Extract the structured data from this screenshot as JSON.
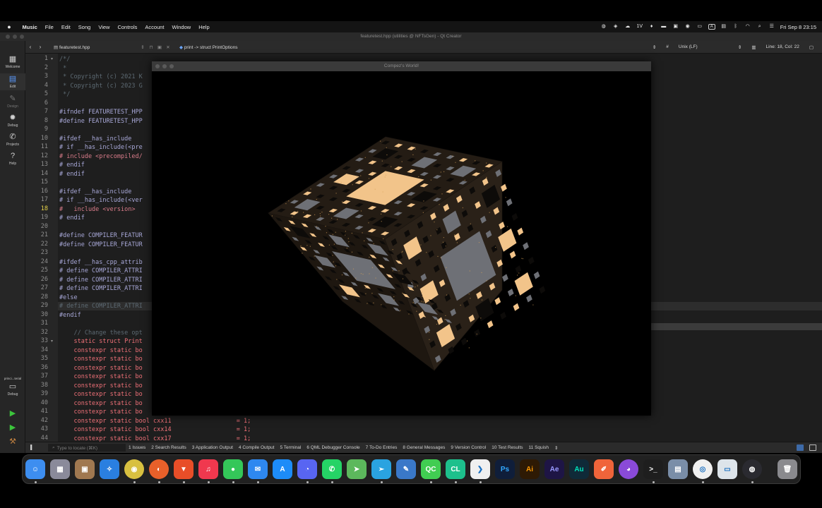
{
  "menubar": {
    "app": "Music",
    "menus": [
      "File",
      "Edit",
      "Song",
      "View",
      "Controls",
      "Account",
      "Window",
      "Help"
    ],
    "status_text": "1V",
    "input_badge": "A",
    "clock": "Fri Sep 8  23:15"
  },
  "qt": {
    "window_title": "featuretest.hpp (utilities @ NFTsGen) - Qt Creator",
    "file_name": "featuretest.hpp",
    "symbol": "print -> struct PrintOptions",
    "line_endings": "Unix (LF)",
    "position": "Line: 18, Col: 22",
    "hash_mark": "#",
    "modes": [
      {
        "icon": "grid-icon",
        "label": "Welcome"
      },
      {
        "icon": "edit-icon",
        "label": "Edit"
      },
      {
        "icon": "design-icon",
        "label": "Design"
      },
      {
        "icon": "debug-icon",
        "label": "Debug"
      },
      {
        "icon": "wrench-icon",
        "label": "Projects"
      },
      {
        "icon": "help-icon",
        "label": "Help"
      }
    ],
    "kit": {
      "name": "princi...terial",
      "config": "Debug"
    },
    "locator_placeholder": "Type to locate (⌘K)",
    "panes": [
      "1  Issues",
      "2  Search Results",
      "3  Application Output",
      "4  Compile Output",
      "5  Terminal",
      "6  QML Debugger Console",
      "7  To-Do Entries",
      "8  General Messages",
      "9  Version Control",
      "10  Test Results",
      "11  Squish"
    ],
    "current_line": 18,
    "code_lines": [
      {
        "n": "1",
        "t": "/*/",
        "c": "c-com"
      },
      {
        "n": "2",
        "t": " *",
        "c": "c-com"
      },
      {
        "n": "3",
        "t": " * Copyright (c) 2021 K",
        "c": "c-com"
      },
      {
        "n": "4",
        "t": " * Copyright (c) 2023 G",
        "c": "c-com"
      },
      {
        "n": "5",
        "t": " */",
        "c": "c-com"
      },
      {
        "n": "6",
        "t": "",
        "c": "c-tx"
      },
      {
        "n": "7",
        "t": "#ifndef FEATURETEST_HPP",
        "c": "c-pp"
      },
      {
        "n": "8",
        "t": "#define FEATURETEST_HPP",
        "c": "c-pp"
      },
      {
        "n": "9",
        "t": "",
        "c": "c-tx"
      },
      {
        "n": "10",
        "t": "#ifdef __has_include",
        "c": "c-pp"
      },
      {
        "n": "11",
        "t": "# if __has_include(<pre",
        "c": "c-pp"
      },
      {
        "n": "12",
        "t": "# include <precompiled/",
        "c": "c-inc"
      },
      {
        "n": "13",
        "t": "# endif",
        "c": "c-pp"
      },
      {
        "n": "14",
        "t": "# endif",
        "c": "c-pp"
      },
      {
        "n": "15",
        "t": "",
        "c": "c-tx"
      },
      {
        "n": "16",
        "t": "#ifdef __has_include",
        "c": "c-pp"
      },
      {
        "n": "17",
        "t": "# if __has_include(<ver",
        "c": "c-pp"
      },
      {
        "n": "18",
        "t": "#   include <version>",
        "c": "c-inc"
      },
      {
        "n": "19",
        "t": "# endif",
        "c": "c-pp"
      },
      {
        "n": "20",
        "t": "",
        "c": "c-tx"
      },
      {
        "n": "21",
        "t": "#define COMPILER_FEATUR",
        "c": "c-pp"
      },
      {
        "n": "22",
        "t": "#define COMPILER_FEATUR",
        "c": "c-pp"
      },
      {
        "n": "23",
        "t": "",
        "c": "c-tx"
      },
      {
        "n": "24",
        "t": "#ifdef __has_cpp_attrib",
        "c": "c-pp"
      },
      {
        "n": "25",
        "t": "# define COMPILER_ATTRI",
        "c": "c-pp"
      },
      {
        "n": "26",
        "t": "# define COMPILER_ATTRI",
        "c": "c-pp"
      },
      {
        "n": "27",
        "t": "# define COMPILER_ATTRI",
        "c": "c-pp"
      },
      {
        "n": "28",
        "t": "#else",
        "c": "c-pp"
      },
      {
        "n": "29",
        "t": "# define COMPILER_ATTRI",
        "c": "c-com"
      },
      {
        "n": "30",
        "t": "#endif",
        "c": "c-pp"
      },
      {
        "n": "31",
        "t": "",
        "c": "c-tx"
      },
      {
        "n": "32",
        "t": "    // Change these opt",
        "c": "c-com"
      },
      {
        "n": "33",
        "t": "    static struct Print",
        "c": "c-kw"
      },
      {
        "n": "34",
        "t": "    constexpr static bo",
        "c": "c-kw"
      },
      {
        "n": "35",
        "t": "    constexpr static bo",
        "c": "c-kw"
      },
      {
        "n": "36",
        "t": "    constexpr static bo",
        "c": "c-kw"
      },
      {
        "n": "37",
        "t": "    constexpr static bo",
        "c": "c-kw"
      },
      {
        "n": "38",
        "t": "    constexpr static bo",
        "c": "c-kw"
      },
      {
        "n": "39",
        "t": "    constexpr static bo",
        "c": "c-kw"
      },
      {
        "n": "40",
        "t": "    constexpr static bo",
        "c": "c-kw"
      },
      {
        "n": "41",
        "t": "    constexpr static bo",
        "c": "c-kw"
      },
      {
        "n": "42",
        "t": "    constexpr static bool cxx11                  = 1;",
        "c": "c-kw"
      },
      {
        "n": "43",
        "t": "    constexpr static bool cxx14                  = 1;",
        "c": "c-kw"
      },
      {
        "n": "44",
        "t": "    constexpr static bool cxx17                  = 1;",
        "c": "c-kw"
      }
    ]
  },
  "gl": {
    "title": "Compez's World!",
    "palette": {
      "edge": "#1a1510",
      "face_top": "#241c14",
      "face_left": "#1e1710",
      "face_right": "#2a2118",
      "hole_light": "#f2c48a",
      "hole_grey": "#6e7076",
      "hole_dark": "#0d0b09",
      "sparkle": "#d8a35a"
    }
  },
  "dock": {
    "apps": [
      {
        "name": "finder-icon",
        "color": "#3d8ef0",
        "glyph": "☺"
      },
      {
        "name": "launchpad-icon",
        "color": "#8a8a9a",
        "glyph": "▦"
      },
      {
        "name": "archive-icon",
        "color": "#a07850",
        "glyph": "▣"
      },
      {
        "name": "safari-icon",
        "color": "#2a7fe0",
        "glyph": "✧"
      },
      {
        "name": "chrome-icon",
        "color": "#d8c040",
        "glyph": "◉"
      },
      {
        "name": "firefox-icon",
        "color": "#e8602a",
        "glyph": "◐"
      },
      {
        "name": "brave-icon",
        "color": "#e84e28",
        "glyph": "▼"
      },
      {
        "name": "music-icon",
        "color": "#f0384e",
        "glyph": "♫"
      },
      {
        "name": "messages-icon",
        "color": "#34c759",
        "glyph": "●"
      },
      {
        "name": "mail-icon",
        "color": "#2e88f0",
        "glyph": "✉"
      },
      {
        "name": "appstore-icon",
        "color": "#1d8cf8",
        "glyph": "A"
      },
      {
        "name": "discord-icon",
        "color": "#5865f2",
        "glyph": "◔"
      },
      {
        "name": "whatsapp-icon",
        "color": "#25d366",
        "glyph": "✆"
      },
      {
        "name": "maps-icon",
        "color": "#5cb85c",
        "glyph": "➤"
      },
      {
        "name": "telegram-icon",
        "color": "#2aa3e0",
        "glyph": "➢"
      },
      {
        "name": "instruments-icon",
        "color": "#3a78c8",
        "glyph": "✎"
      },
      {
        "name": "qtcreator-icon",
        "color": "#41cd52",
        "glyph": "QC"
      },
      {
        "name": "clion-icon",
        "color": "#1dc08c",
        "glyph": "CL"
      },
      {
        "name": "vscode-icon",
        "color": "#f0f0f0",
        "glyph": "❯"
      },
      {
        "name": "photoshop-icon",
        "color": "#0f1e3a",
        "glyph": "Ps"
      },
      {
        "name": "illustrator-icon",
        "color": "#2e1a04",
        "glyph": "Ai"
      },
      {
        "name": "aftereffects-icon",
        "color": "#1e1545",
        "glyph": "Ae"
      },
      {
        "name": "audition-icon",
        "color": "#0f2a38",
        "glyph": "Au"
      },
      {
        "name": "pencil-app-icon",
        "color": "#f0643a",
        "glyph": "✐"
      },
      {
        "name": "github-icon",
        "color": "#8a4ad8",
        "glyph": "◕"
      },
      {
        "name": "terminal-icon",
        "color": "#1e1e1e",
        "glyph": ">_"
      },
      {
        "name": "preview-icon",
        "color": "#7a8ea8",
        "glyph": "▤"
      },
      {
        "name": "vpn-icon",
        "color": "#f0f0f0",
        "glyph": "◎"
      },
      {
        "name": "notes-icon",
        "color": "#dde4ea",
        "glyph": "▭"
      },
      {
        "name": "obs-icon",
        "color": "#2a2a30",
        "glyph": "◍"
      },
      {
        "name": "trash-icon",
        "color": "#8a8a8e",
        "glyph": "🗑"
      }
    ]
  }
}
